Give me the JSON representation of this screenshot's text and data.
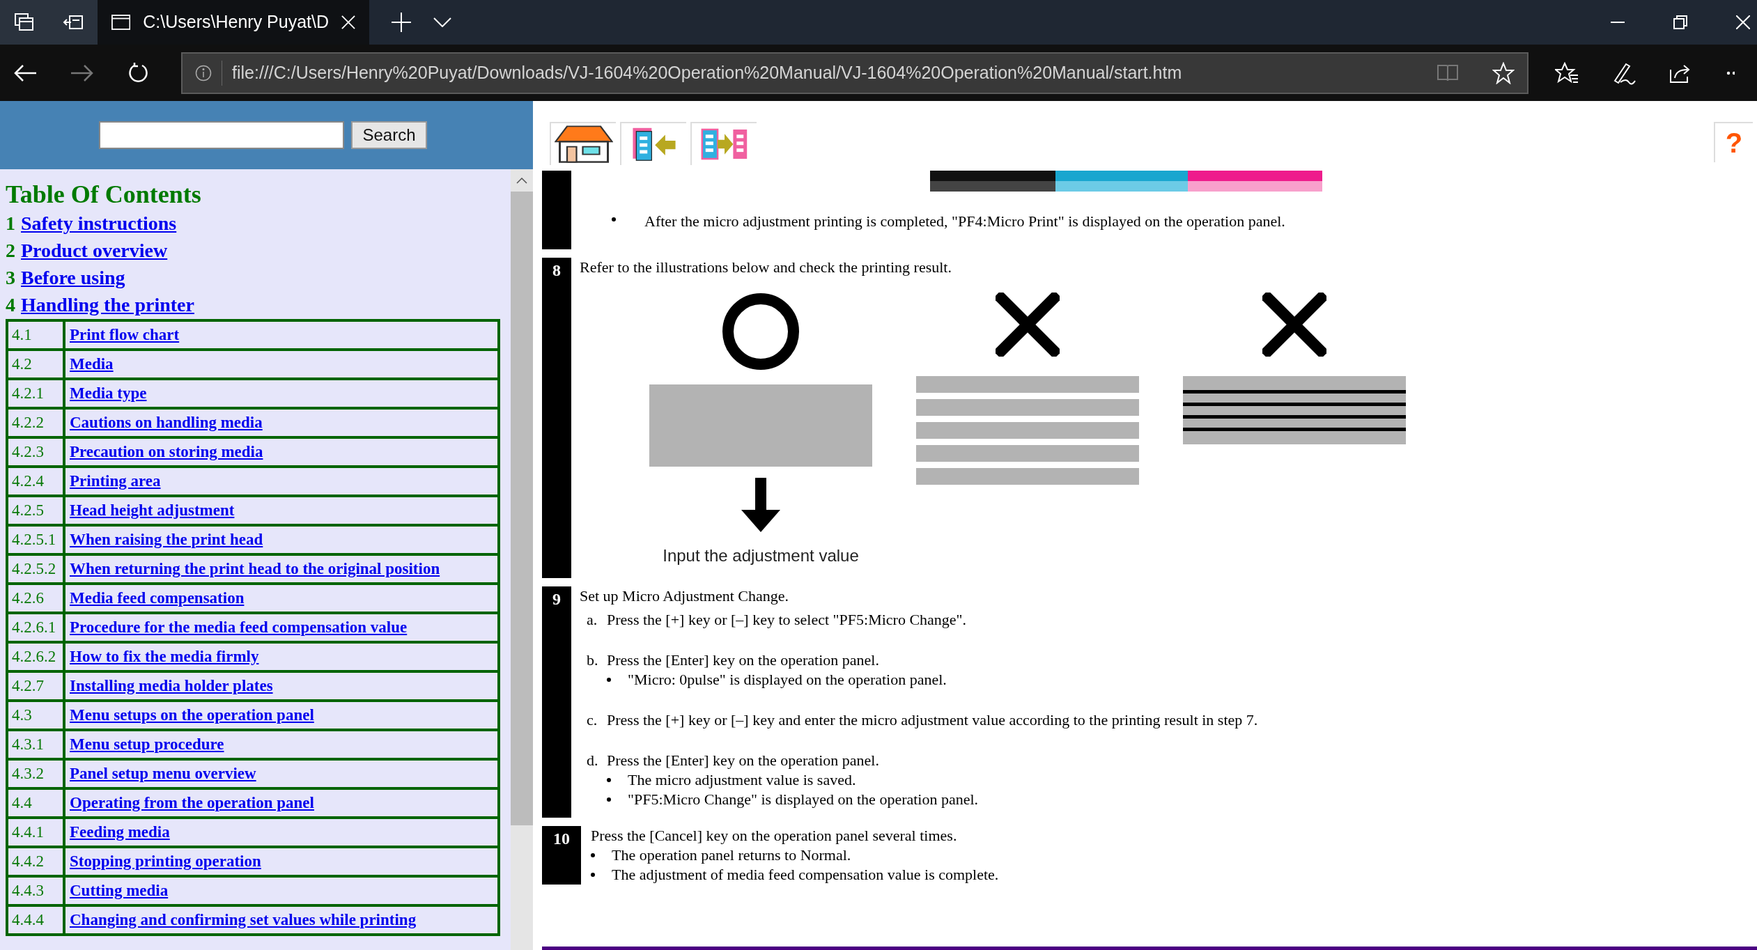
{
  "browser": {
    "tab_title": "C:\\Users\\Henry Puyat\\D",
    "address": "file:///C:/Users/Henry%20Puyat/Downloads/VJ-1604%20Operation%20Manual/VJ-1604%20Operation%20Manual/start.htm"
  },
  "search": {
    "button": "Search"
  },
  "toc": {
    "title": "Table Of Contents",
    "chapters": [
      {
        "number": "1",
        "title": "Safety instructions"
      },
      {
        "number": "2",
        "title": "Product overview"
      },
      {
        "number": "3",
        "title": "Before using"
      },
      {
        "number": "4",
        "title": "Handling the printer"
      }
    ],
    "sections": [
      {
        "number": "4.1",
        "title": "Print flow chart"
      },
      {
        "number": "4.2",
        "title": "Media"
      },
      {
        "number": "4.2.1",
        "title": "Media type"
      },
      {
        "number": "4.2.2",
        "title": "Cautions on handling media"
      },
      {
        "number": "4.2.3",
        "title": "Precaution on storing media"
      },
      {
        "number": "4.2.4",
        "title": "Printing area"
      },
      {
        "number": "4.2.5",
        "title": "Head height adjustment"
      },
      {
        "number": "4.2.5.1",
        "title": "When raising the print head"
      },
      {
        "number": "4.2.5.2",
        "title": "When returning the print head to the original position"
      },
      {
        "number": "4.2.6",
        "title": "Media feed compensation"
      },
      {
        "number": "4.2.6.1",
        "title": "Procedure for the media feed compensation value"
      },
      {
        "number": "4.2.6.2",
        "title": "How to fix the media firmly"
      },
      {
        "number": "4.2.7",
        "title": "Installing media holder plates"
      },
      {
        "number": "4.3",
        "title": "Menu setups on the operation panel"
      },
      {
        "number": "4.3.1",
        "title": "Menu setup procedure"
      },
      {
        "number": "4.3.2",
        "title": "Panel setup menu overview"
      },
      {
        "number": "4.4",
        "title": "Operating from the operation panel"
      },
      {
        "number": "4.4.1",
        "title": "Feeding media"
      },
      {
        "number": "4.4.2",
        "title": "Stopping printing operation"
      },
      {
        "number": "4.4.3",
        "title": "Cutting media"
      },
      {
        "number": "4.4.4",
        "title": "Changing and confirming set values while printing"
      }
    ]
  },
  "help": "?",
  "prev_step_note": "After the micro adjustment printing is completed, \"PF4:Micro Print\" is displayed on the operation panel.",
  "steps": [
    {
      "number": "8",
      "text": "Refer to the illustrations below and check the printing result.",
      "panels": [
        {
          "kind": "good",
          "caption": "Input the adjustment value"
        },
        {
          "kind": "gaps"
        },
        {
          "kind": "lines"
        }
      ]
    },
    {
      "number": "9",
      "text": "Set up Micro Adjustment Change.",
      "substeps": [
        {
          "letter": "a.",
          "text": "Press the [+] key or [–] key to select \"PF5:Micro Change\"."
        },
        {
          "letter": "b.",
          "text": "Press the [Enter] key on the operation panel.",
          "bullets": [
            "\"Micro: 0pulse\" is displayed on the operation panel."
          ]
        },
        {
          "letter": "c.",
          "text": "Press the [+] key or [–] key and enter the micro adjustment value according to the printing result in step 7."
        },
        {
          "letter": "d.",
          "text": "Press the [Enter] key on the operation panel.",
          "bullets": [
            "The micro adjustment value is saved.",
            "\"PF5:Micro Change\" is displayed on the operation panel."
          ]
        }
      ]
    },
    {
      "number": "10",
      "text": "Press the [Cancel] key on the operation panel several times.",
      "bullets": [
        "The operation panel returns to Normal.",
        "The adjustment of media feed compensation value is complete."
      ]
    }
  ]
}
